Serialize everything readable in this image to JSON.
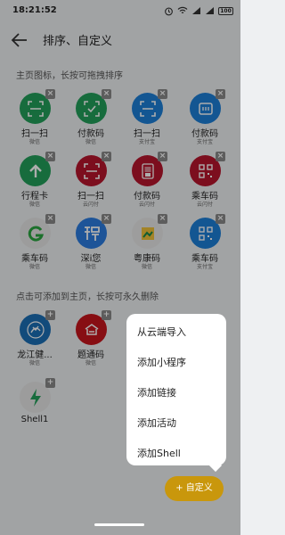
{
  "status": {
    "time": "18:21:52",
    "battery": "100"
  },
  "header": {
    "title": "排序、自定义"
  },
  "hints": {
    "top": "主页图标，长按可拖拽排序",
    "bottom": "点击可添加到主页，长按可永久删除"
  },
  "home_items": [
    {
      "label": "扫一扫",
      "sub": "微信",
      "icon": "scan-icon",
      "bg": "#23a05a",
      "badge": "×"
    },
    {
      "label": "付款码",
      "sub": "微信",
      "icon": "pay-code-check-icon",
      "bg": "#23a05a",
      "badge": "×"
    },
    {
      "label": "扫一扫",
      "sub": "支付宝",
      "icon": "scan-icon",
      "bg": "#1d7fd8",
      "badge": "×"
    },
    {
      "label": "付款码",
      "sub": "支付宝",
      "icon": "pay-code-icon",
      "bg": "#1d7fd8",
      "badge": "×"
    },
    {
      "label": "行程卡",
      "sub": "微信",
      "icon": "arrow-up-icon",
      "bg": "#23a05a",
      "badge": "×"
    },
    {
      "label": "扫一扫",
      "sub": "云闪付",
      "icon": "scan-icon",
      "bg": "#b7162d",
      "badge": "×"
    },
    {
      "label": "付款码",
      "sub": "云闪付",
      "icon": "barcode-icon",
      "bg": "#b7162d",
      "badge": "×"
    },
    {
      "label": "乘车码",
      "sub": "云闪付",
      "icon": "qr-code-icon",
      "bg": "#b7162d",
      "badge": "×"
    },
    {
      "label": "乘车码",
      "sub": "微信",
      "icon": "green-g-logo-icon",
      "bg": "#e6e6e6",
      "badge": "×"
    },
    {
      "label": "深i您",
      "sub": "微信",
      "icon": "shen-logo-icon",
      "bg": "#2c7de0",
      "badge": "×"
    },
    {
      "label": "粤康码",
      "sub": "微信",
      "icon": "yue-logo-icon",
      "bg": "#e8e8e8",
      "badge": "×"
    },
    {
      "label": "乘车码",
      "sub": "支付宝",
      "icon": "qr-code-icon",
      "bg": "#1d7fd8",
      "badge": "×"
    }
  ],
  "available_items": [
    {
      "label": "龙江健...",
      "sub": "微信",
      "icon": "longjiang-logo-icon",
      "bg": "#1b6fb5",
      "badge": "+"
    },
    {
      "label": "题通码",
      "sub": "微信",
      "icon": "tiantong-logo-icon",
      "bg": "#c8161d",
      "badge": "+"
    },
    {
      "label": "Shell1",
      "sub": "",
      "icon": "lightning-icon",
      "bg": "#e6e6e6",
      "badge": "+"
    }
  ],
  "menu": {
    "items": [
      "从云端导入",
      "添加小程序",
      "添加链接",
      "添加活动",
      "添加Shell"
    ]
  },
  "fab": {
    "label": "+ 自定义"
  }
}
